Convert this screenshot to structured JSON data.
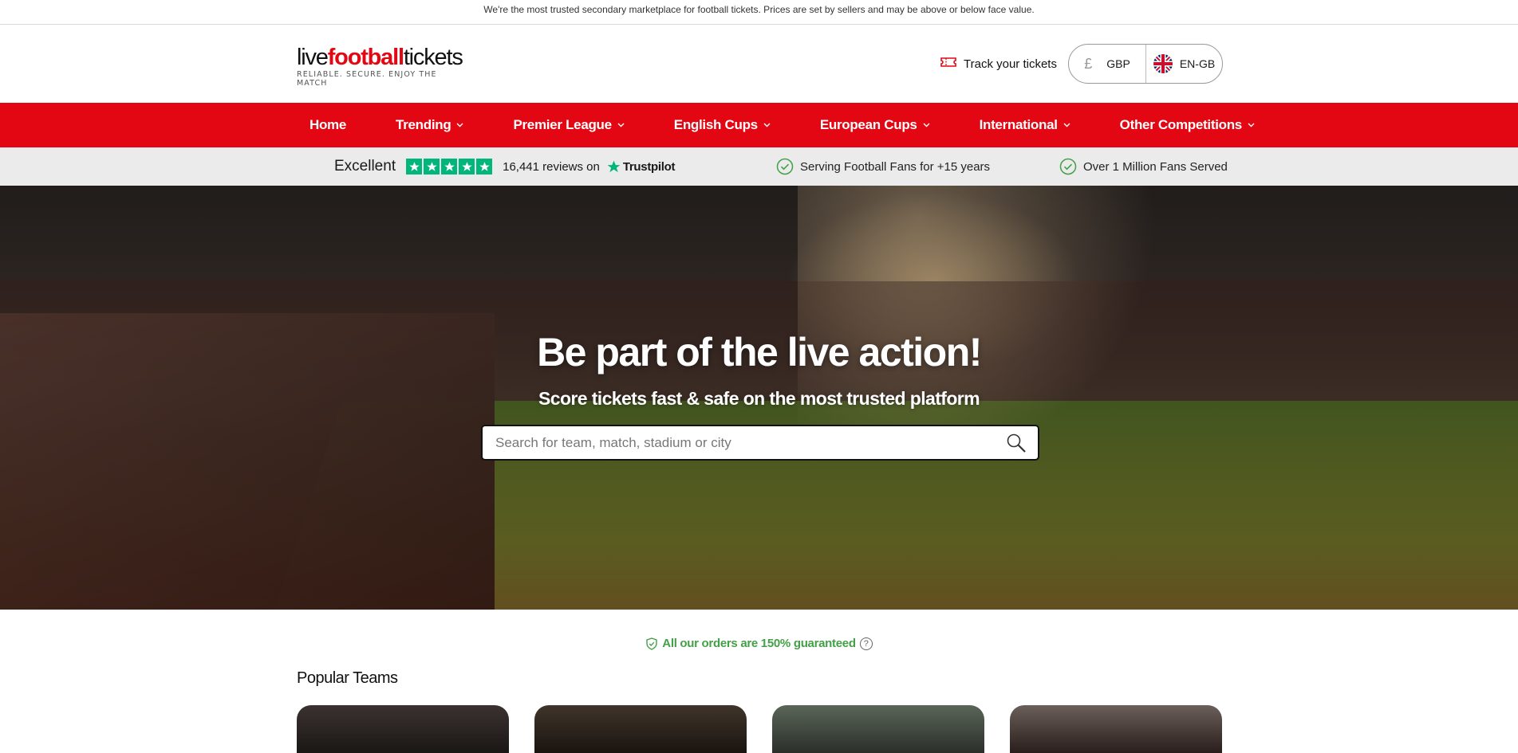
{
  "topbar": {
    "text": "We're the most trusted secondary marketplace for football tickets. Prices are set by sellers and may be above or below face value."
  },
  "header": {
    "logo": {
      "part1": "live",
      "part2": "football",
      "part3": "tickets",
      "tagline": "RELIABLE. SECURE. ENJOY THE MATCH"
    },
    "track_label": "Track your tickets",
    "currency_symbol": "£",
    "currency": "GBP",
    "language": "EN-GB"
  },
  "nav": {
    "items": [
      {
        "label": "Home",
        "dropdown": false
      },
      {
        "label": "Trending",
        "dropdown": true
      },
      {
        "label": "Premier League",
        "dropdown": true
      },
      {
        "label": "English Cups",
        "dropdown": true
      },
      {
        "label": "European Cups",
        "dropdown": true
      },
      {
        "label": "International",
        "dropdown": true
      },
      {
        "label": "Other Competitions",
        "dropdown": true
      }
    ]
  },
  "trustbar": {
    "rating_label": "Excellent",
    "reviews": "16,441 reviews on",
    "brand": "Trustpilot",
    "usp1": "Serving Football Fans for +15 years",
    "usp2": "Over 1 Million Fans Served"
  },
  "hero": {
    "title": "Be part of the live action!",
    "subtitle": "Score tickets fast & safe on the most trusted platform",
    "search_placeholder": "Search for team, match, stadium or city"
  },
  "guarantee": {
    "text": "All our orders are 150% guaranteed",
    "info": "?"
  },
  "popular": {
    "title": "Popular Teams"
  },
  "colors": {
    "brand_red": "#e30613",
    "trustpilot_green": "#00b67a",
    "guarantee_green": "#43a047"
  }
}
